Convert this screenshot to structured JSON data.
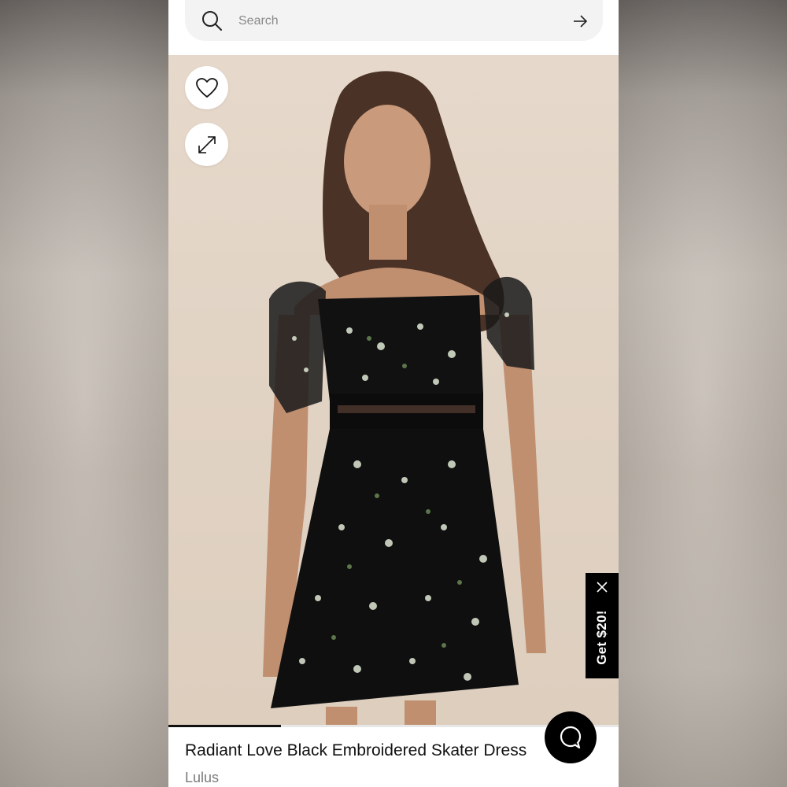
{
  "search": {
    "placeholder": "Search"
  },
  "product": {
    "title": "Radiant Love Black Embroidered Skater Dress",
    "brand": "Lulus",
    "image_alt": "model wearing black floral embroidered dress"
  },
  "gallery": {
    "progress_fraction": 0.25
  },
  "promo": {
    "label": "Get $20!"
  },
  "icons": {
    "search": "search-icon",
    "submit": "arrow-right-icon",
    "wishlist": "heart-icon",
    "expand": "expand-icon",
    "close": "close-icon",
    "chat": "chat-bubble-icon"
  },
  "colors": {
    "background": "#ffffff",
    "accent": "#000000",
    "search_bg": "#f3f3f3",
    "photo_bg": "#e2d4c5"
  }
}
